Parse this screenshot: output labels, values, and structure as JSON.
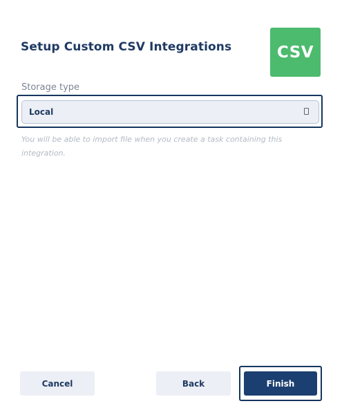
{
  "dialog": {
    "title": "Setup Custom CSV Integrations",
    "logo_text": "CSV",
    "logo_color": "#4cbb6e"
  },
  "storage": {
    "label": "Storage type",
    "selected": "Local",
    "hint": "You will be able to import file when you create a task containing this integration."
  },
  "footer": {
    "cancel_label": "Cancel",
    "back_label": "Back",
    "finish_label": "Finish"
  },
  "colors": {
    "primary": "#1b3f70",
    "focus_ring": "#15355e",
    "secondary_bg": "#eceff5"
  }
}
